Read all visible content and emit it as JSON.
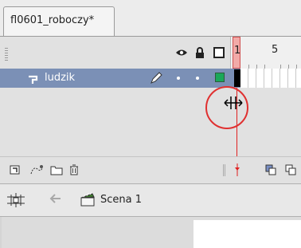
{
  "document": {
    "tab_title": "fl0601_roboczy*"
  },
  "timeline": {
    "header_icons": [
      "eye-icon",
      "lock-icon",
      "outline-icon"
    ],
    "frame_numbers": [
      "1",
      "5"
    ],
    "current_frame": 1,
    "layer": {
      "name": "ludzik",
      "outline_color": "#1aa85a"
    },
    "highlight_color": "#e03030"
  },
  "edit_bar": {
    "scene_label": "Scena 1"
  },
  "colors": {
    "layer_selected": "#7b90b6",
    "playhead": "#e02020"
  }
}
